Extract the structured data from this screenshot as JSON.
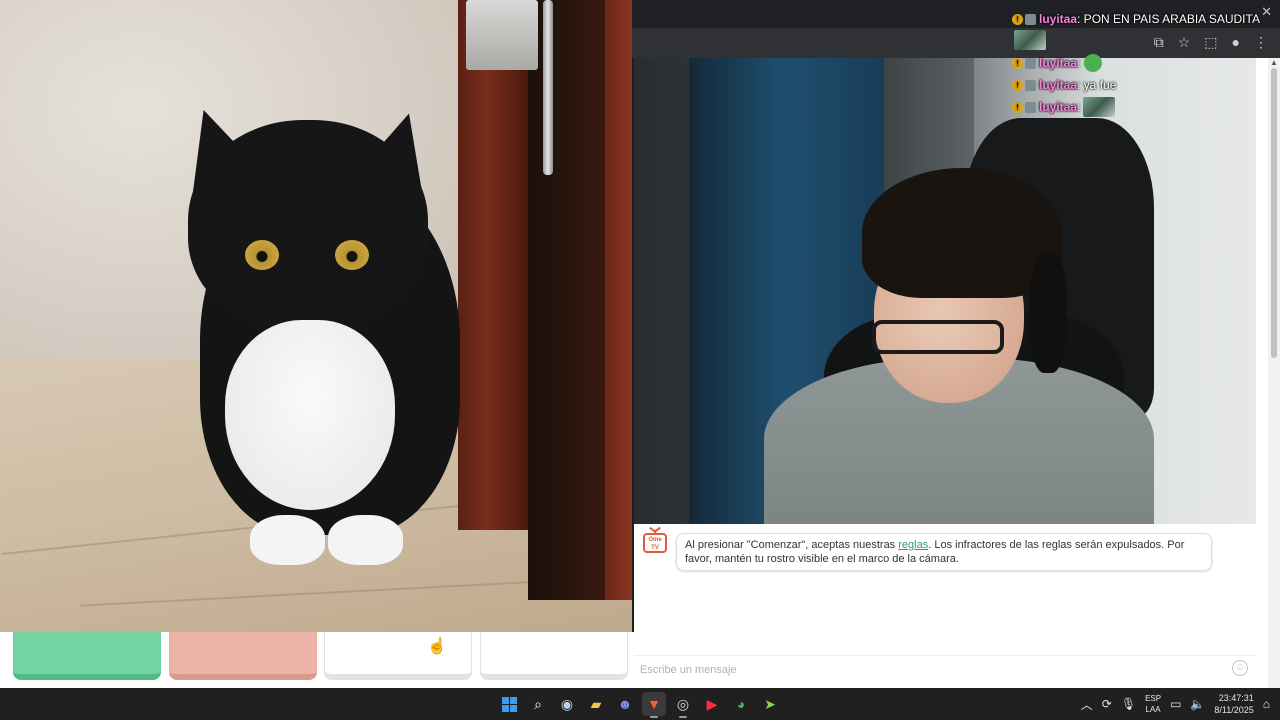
{
  "chat_overlay": {
    "messages": [
      {
        "user": "luyitaa",
        "text": ": PON EN PAIS ARABIA SAUDITA",
        "emote": ""
      },
      {
        "user": "",
        "text": "",
        "emote": "pixel-emote"
      },
      {
        "user": "luyitaa",
        "text": ":",
        "emote": "frog-emote"
      },
      {
        "user": "luyitaa",
        "text": ": ya fue",
        "emote": ""
      },
      {
        "user": "luyitaa",
        "text": ":",
        "emote": "pixel-emote"
      }
    ]
  },
  "chat_panel": {
    "logo_text": "Ome TV",
    "notice": {
      "before_link": "Al presionar \"Comenzar\", aceptas nuestras ",
      "link": "reglas",
      "after_link": ". Los infractores de las reglas serán expulsados. Por favor, mantén tu rostro visible en el marco de la cámara."
    },
    "input_placeholder": "Escribe un mensaje",
    "emoji_icon": "emoji-icon"
  },
  "browser": {
    "icons": [
      "screen-share-icon",
      "star-icon",
      "extensions-icon",
      "profile-icon",
      "menu-icon"
    ],
    "close_icon": "close-icon"
  },
  "controls": {
    "start_color": "#74d3a3",
    "stop_color": "#ecb3a7"
  },
  "taskbar": {
    "apps": [
      "windows-start-icon",
      "search-icon",
      "steam-icon",
      "file-explorer-icon",
      "discord-icon",
      "brave-icon",
      "obs-icon",
      "youtube-music-icon",
      "chrome-icon",
      "game-launcher-icon"
    ],
    "tray": {
      "language_top": "ESP",
      "language_bottom": "LAA",
      "time": "23:47:31",
      "date": "8/11/2025"
    }
  }
}
